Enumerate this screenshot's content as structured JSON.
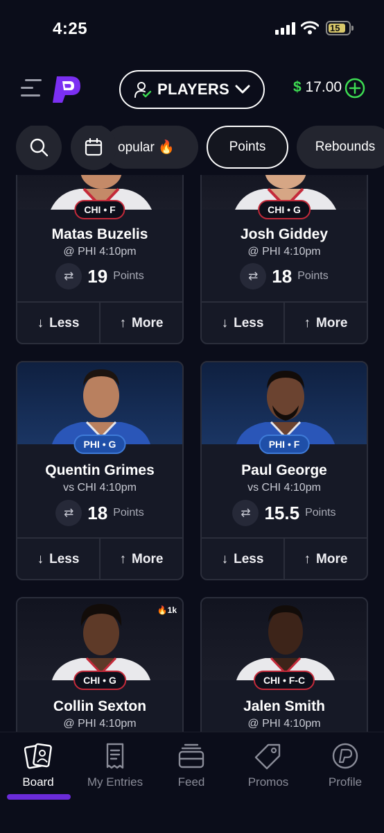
{
  "status_bar": {
    "time": "4:25",
    "battery": "15"
  },
  "header": {
    "players_label": "PLAYERS",
    "balance_symbol": "$",
    "balance_amount": "17.00",
    "accent_green": "#3ddc52",
    "brand_purple": "#7b2ff2"
  },
  "filters": {
    "chips": [
      {
        "label": "opular 🔥"
      },
      {
        "label": "Points"
      },
      {
        "label": "Rebounds"
      }
    ],
    "active": "Points"
  },
  "cards": [
    {
      "team": "CHI • F",
      "name": "Matas Buzelis",
      "game_prefix": "@",
      "opp": "PHI",
      "time": "4:10pm",
      "line": "19",
      "stat": "Points",
      "less": "Less",
      "more": "More"
    },
    {
      "team": "CHI • G",
      "name": "Josh Giddey",
      "game_prefix": "@",
      "opp": "PHI",
      "time": "4:10pm",
      "line": "18",
      "stat": "Points",
      "less": "Less",
      "more": "More"
    },
    {
      "team": "PHI • G",
      "name": "Quentin Grimes",
      "game_prefix": "vs",
      "opp": "CHI",
      "time": "4:10pm",
      "line": "18",
      "stat": "Points",
      "less": "Less",
      "more": "More"
    },
    {
      "team": "PHI • F",
      "name": "Paul George",
      "game_prefix": "vs",
      "opp": "CHI",
      "time": "4:10pm",
      "line": "15.5",
      "stat": "Points",
      "less": "Less",
      "more": "More"
    },
    {
      "team": "CHI • G",
      "name": "Collin Sexton",
      "game_prefix": "@",
      "opp": "PHI",
      "time": "4:10pm",
      "hot": "🔥1k"
    },
    {
      "team": "CHI • F-C",
      "name": "Jalen Smith",
      "game_prefix": "@",
      "opp": "PHI",
      "time": "4:10pm"
    }
  ],
  "bottom_nav": [
    {
      "label": "Board",
      "icon": "board-icon",
      "active": true
    },
    {
      "label": "My Entries",
      "icon": "receipt-icon"
    },
    {
      "label": "Feed",
      "icon": "feed-icon"
    },
    {
      "label": "Promos",
      "icon": "tag-icon"
    },
    {
      "label": "Profile",
      "icon": "profile-icon"
    }
  ]
}
